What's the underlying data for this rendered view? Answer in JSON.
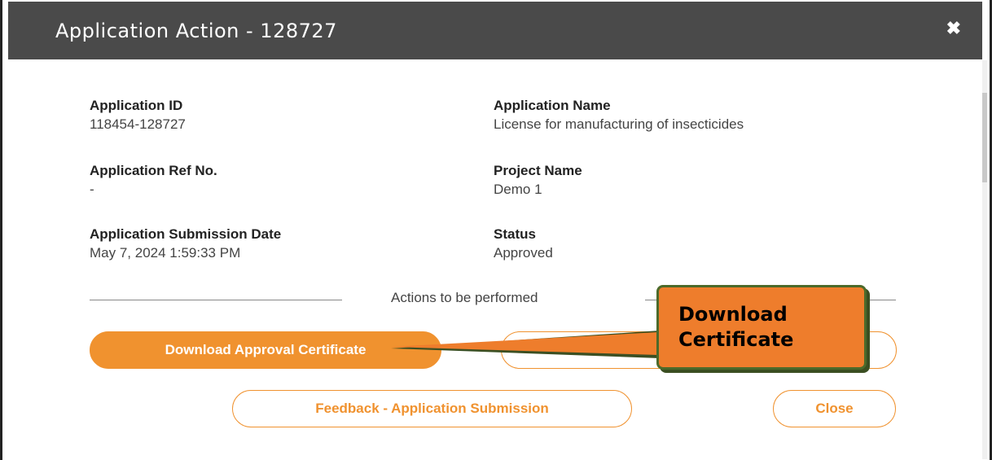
{
  "dialog": {
    "title": "Application Action - 128727",
    "close_glyph": "✖"
  },
  "fields": {
    "application_id": {
      "label": "Application ID",
      "value": "118454-128727"
    },
    "application_name": {
      "label": "Application Name",
      "value": "License for manufacturing of insecticides"
    },
    "application_ref": {
      "label": "Application Ref No.",
      "value": "-"
    },
    "project_name": {
      "label": "Project Name",
      "value": "Demo 1"
    },
    "submission_date": {
      "label": "Application Submission Date",
      "value": "May 7, 2024 1:59:33 PM"
    },
    "status": {
      "label": "Status",
      "value": "Approved"
    }
  },
  "actions": {
    "section_label": "Actions to be performed",
    "download_label": "Download Approval Certificate",
    "feedback_label": "Feedback - Application Submission",
    "close_label": "Close"
  },
  "annotation": {
    "line1": "Download",
    "line2": "Certificate"
  },
  "colors": {
    "accent": "#f0922f",
    "header_bg": "#4a4a4a",
    "callout_bg": "#ee7d2c",
    "callout_border": "#4c6a2a"
  }
}
